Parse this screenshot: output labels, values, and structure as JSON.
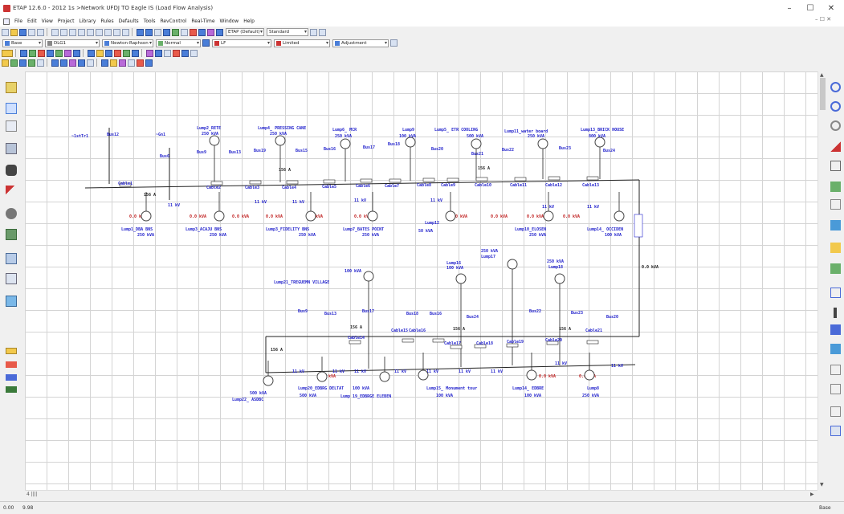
{
  "titlebar": {
    "title": "ETAP 12.6.0 - 2012 1s >Network UFDJ TO Eagle IS (Load Flow Analysis)",
    "minimize": "–",
    "maximize": "☐",
    "close": "✕"
  },
  "menubar": {
    "items": [
      "File",
      "Edit",
      "View",
      "Project",
      "Library",
      "Rules",
      "Defaults",
      "Tools",
      "RevControl",
      "Real-Time",
      "Window",
      "Help"
    ],
    "mdi_restore": "– ☐ ✕"
  },
  "toolbar1": {
    "study_dropdown": "ETAP (Default)",
    "mode_dropdown": "Standard"
  },
  "toolbar2": {
    "base_dropdown": "Base",
    "case_dropdown": "DLG1",
    "method_dropdown": "Newton-Raphson",
    "loading_dropdown": "Normal",
    "config_dropdown": "LF",
    "level_dropdown": "Limited",
    "adjust_dropdown": "Adjustment"
  },
  "canvas": {
    "bus_labels": [
      "~1stTr1",
      "Bus12",
      "~Gn1",
      "Bus6",
      "Bus9",
      "Bus13",
      "Bus19",
      "Bus15",
      "Bus16",
      "Bus17",
      "Bus18",
      "Bus20",
      "Bus21",
      "Bus22",
      "Bus23",
      "Bus24"
    ],
    "top_lump_labels": [
      {
        "name": "Lump2_RETE",
        "kva": "250 kVA"
      },
      {
        "name": "Lump4_ PRESSING CANE",
        "kva": "250 kVA"
      },
      {
        "name": "Lump6_ MCR",
        "kva": "250 kVA"
      },
      {
        "name": "Lump9",
        "kva": "100 kVA"
      },
      {
        "name": "Lump5_ ETR COOLING",
        "kva": "500 kVA"
      },
      {
        "name": "Lump11_water board",
        "kva": "250 kVA"
      },
      {
        "name": "Lump13_BRICK HOUSE",
        "kva": "800 kVA"
      }
    ],
    "bottom_lump_labels": [
      {
        "name": "Lump1_DBA BNS",
        "kva": "250 kVA"
      },
      {
        "name": "Lump3_ACAJU BNS",
        "kva": "250 kVA"
      },
      {
        "name": "Lump3_FIDELITY BNS",
        "kva": "250 kVA"
      },
      {
        "name": "Lump7_BATES POINT",
        "kva": "250 kVA"
      },
      {
        "name": "Lump12",
        "kva": "50 kVA"
      },
      {
        "name": "Lump10_ELOSEN",
        "kva": "250 kVA"
      },
      {
        "name": "Lump14_ OCCIDEN",
        "kva": "100 kVA"
      }
    ],
    "lower_lump_labels": [
      {
        "name": "Lump21_TREGUEMN VILLAGE",
        "kva": "100 kVA"
      },
      {
        "name": "Lump16",
        "kva": "100 kVA"
      },
      {
        "name": "Lump17",
        "kva": "250 kVA"
      },
      {
        "name": "Lump18",
        "kva": "250 kVA"
      },
      {
        "name": "Lump22_ ASDBC",
        "kva": "500 kVA"
      },
      {
        "name": "Lump20_EDBRG DELTAT",
        "kva": "500 kVA"
      },
      {
        "name": "Lump 19_EDBRGE ELEBEN",
        "kva": "100 kVA"
      },
      {
        "name": "Lump15_ Monument tour",
        "kva": "100 kVA"
      },
      {
        "name": "Lump14_ EDBRE",
        "kva": "100 kVA"
      },
      {
        "name": "Lump8",
        "kva": "250 kVA"
      }
    ],
    "cable_labels": [
      "Cable1",
      "Cable2",
      "Cable3",
      "Cable4",
      "Cable5",
      "Cable6",
      "Cable7",
      "Cable8",
      "Cable9",
      "Cable10",
      "Cable11",
      "Cable12",
      "Cable13",
      "Cable14",
      "Cable15",
      "Cable16",
      "Cable17",
      "Cable18",
      "Cable19",
      "Cable20",
      "Cable21"
    ],
    "voltage_label": "11 kV",
    "power_reading": "0.0 kVA",
    "riser_reading": "0.0 kVA",
    "current_reading": "156 A"
  },
  "status": {
    "left1": "0.00",
    "left2": "9.98",
    "right": "Base"
  },
  "hscroll": {
    "label": "4 ||||"
  }
}
